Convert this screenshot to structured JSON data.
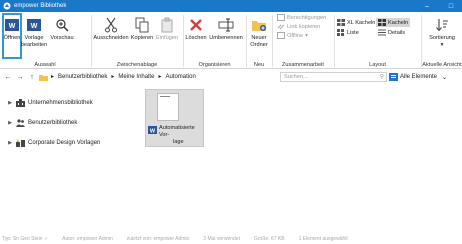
{
  "window": {
    "title": "empower Bibliothek",
    "minimize_symbol": "–",
    "maximize_symbol": "□"
  },
  "ribbon": {
    "groups": {
      "auswahl": "Auswahl",
      "zwischenablage": "Zwischenablage",
      "organisieren": "Organisieren",
      "neu": "Neu",
      "zusammenarbeit": "Zusammenarbeit",
      "layout": "Layout",
      "aktuelle_ansicht": "Aktuelle Ansicht"
    },
    "buttons": {
      "oeffnen": "Öffnen",
      "vorlage_bearbeiten_1": "Vorlage",
      "vorlage_bearbeiten_2": "bearbeiten",
      "vorschau": "Vorschau",
      "ausschneiden": "Ausschneiden",
      "kopieren": "Kopieren",
      "einfuegen": "Einfügen",
      "loeschen": "Löschen",
      "umbenennen": "Umbenennen",
      "neuer_ordner_1": "Neuer",
      "neuer_ordner_2": "Ordner",
      "berechtigungen": "Berechtigungen",
      "link_kopieren": "Link kopieren",
      "offline": "Offline",
      "xl_kacheln": "XL Kacheln",
      "kacheln": "Kacheln",
      "liste": "Liste",
      "details": "Details",
      "sortierung": "Sortierung"
    }
  },
  "address": {
    "back": "←",
    "forward": "→",
    "up": "↑",
    "crumbs": [
      "Benutzerbibliothek",
      "Meine Inhalte",
      "Automation"
    ],
    "search_placeholder": "Suchen...",
    "filter": "Alle Elemente"
  },
  "tree": {
    "items": [
      {
        "label": "Unternehmensbibliothek"
      },
      {
        "label": "Benutzerbibliothek"
      },
      {
        "label": "Corporate Design Vorlagen"
      }
    ]
  },
  "content": {
    "tile_label_1": "Automatisierte Vor-",
    "tile_label_2": "lage"
  },
  "status": {
    "items": [
      "Typ: Sn Geo Stein ✓",
      "Autor: empower Admin",
      "zuletzt von: empower Admin",
      "3 Mal verwendet",
      "Größe: 67 KB",
      "1 Element ausgewählt"
    ]
  },
  "colors": {
    "titlebar": "#1978c8",
    "accent": "#2d9ad6",
    "word_blue": "#2b5797",
    "folder": "#f2c14e",
    "delete_red": "#d83b3b"
  }
}
